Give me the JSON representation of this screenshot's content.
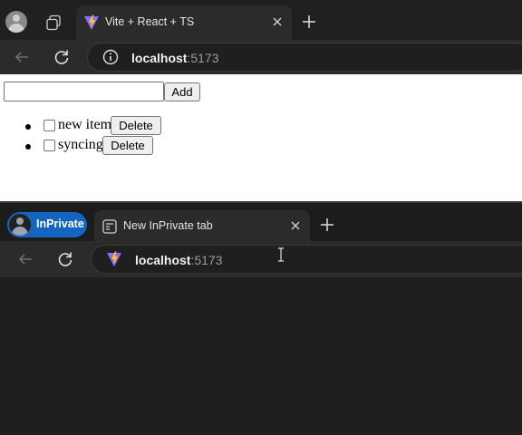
{
  "window1": {
    "tab": {
      "title": "Vite + React + TS"
    },
    "address": {
      "host": "localhost",
      "port": ":5173"
    },
    "page": {
      "input": {
        "value": "",
        "placeholder": ""
      },
      "add_label": "Add",
      "items": [
        {
          "text": "new item",
          "checked": false,
          "delete_label": "Delete"
        },
        {
          "text": "syncing",
          "checked": false,
          "delete_label": "Delete"
        }
      ]
    }
  },
  "window2": {
    "badge": "InPrivate",
    "tab": {
      "title": "New InPrivate tab"
    },
    "address": {
      "host": "localhost",
      "port": ":5173"
    }
  },
  "icons": {
    "profile": "profile-icon",
    "workspaces": "workspaces-icon",
    "vite": "vite-favicon-icon",
    "close": "close-icon",
    "new_tab": "plus-icon",
    "back": "back-arrow-icon",
    "refresh": "refresh-icon",
    "info": "info-icon"
  },
  "colors": {
    "inprivate_accent": "#1565c0",
    "vite_purple": "#8c6cff",
    "vite_yellow": "#ffc517"
  }
}
